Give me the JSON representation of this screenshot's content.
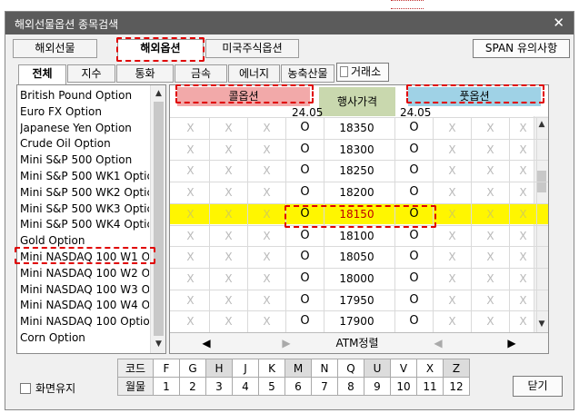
{
  "window": {
    "title": "해외선물옵션 종목검색",
    "close_glyph": "✕"
  },
  "main_tabs": [
    {
      "label": "해외선물",
      "active": false
    },
    {
      "label": "해외옵션",
      "active": true
    },
    {
      "label": "미국주식옵션",
      "active": false
    }
  ],
  "span_button": "SPAN 유의사항",
  "sub_tabs": [
    {
      "label": "전체",
      "active": true
    },
    {
      "label": "지수",
      "active": false
    },
    {
      "label": "통화",
      "active": false
    },
    {
      "label": "금속",
      "active": false
    },
    {
      "label": "에너지",
      "active": false
    },
    {
      "label": "농축산물",
      "active": false
    }
  ],
  "more_button": "거래소",
  "products": [
    "British Pound Option",
    "Euro FX Option",
    "Japanese Yen Option",
    "Crude Oil Option",
    "Mini S&P 500 Option",
    "Mini S&P 500 WK1 Optic",
    "Mini S&P 500 WK2 Optic",
    "Mini S&P 500 WK3 Optic",
    "Mini S&P 500 WK4 Optic",
    "Gold Option",
    "Mini NASDAQ 100 W1 O",
    "Mini NASDAQ 100 W2 O",
    "Mini NASDAQ 100 W3 O",
    "Mini NASDAQ 100 W4 O",
    "Mini NASDAQ 100 Optio",
    "Corn Option"
  ],
  "selected_product_index": 10,
  "board": {
    "call_header": "콜옵션",
    "put_header": "풋옵션",
    "strike_header": "행사가격",
    "call_month": "24.05",
    "put_month": "24.05",
    "x_glyph": "X",
    "circle_glyph": "O",
    "strikes": [
      "18350",
      "18300",
      "18250",
      "18200",
      "18150",
      "18100",
      "18050",
      "18000",
      "17950",
      "17900"
    ],
    "atm_index": 4,
    "nav_left": "◀",
    "nav_left2": "▶",
    "atm_label": "ATM정렬",
    "nav_right2": "◀",
    "nav_right": "▶"
  },
  "month_codes": {
    "code_label": "코드",
    "month_label": "월물",
    "codes": [
      "F",
      "G",
      "H",
      "J",
      "K",
      "M",
      "N",
      "Q",
      "U",
      "V",
      "X",
      "Z"
    ],
    "months": [
      "1",
      "2",
      "3",
      "4",
      "5",
      "6",
      "7",
      "8",
      "9",
      "10",
      "11",
      "12"
    ],
    "shaded": [
      "H",
      "M",
      "U",
      "Z"
    ]
  },
  "keep_screen_label": "화면유지",
  "close_button": "닫기",
  "colors": {
    "titlebar": "#5b5b5b",
    "call_header_bg": "#f2a9a9",
    "put_header_bg": "#9fd2e6",
    "strike_header_bg": "#c9d8ae",
    "atm_row_bg": "#fff600",
    "atm_strike_text": "#c00000",
    "highlight_border": "#e00000"
  }
}
